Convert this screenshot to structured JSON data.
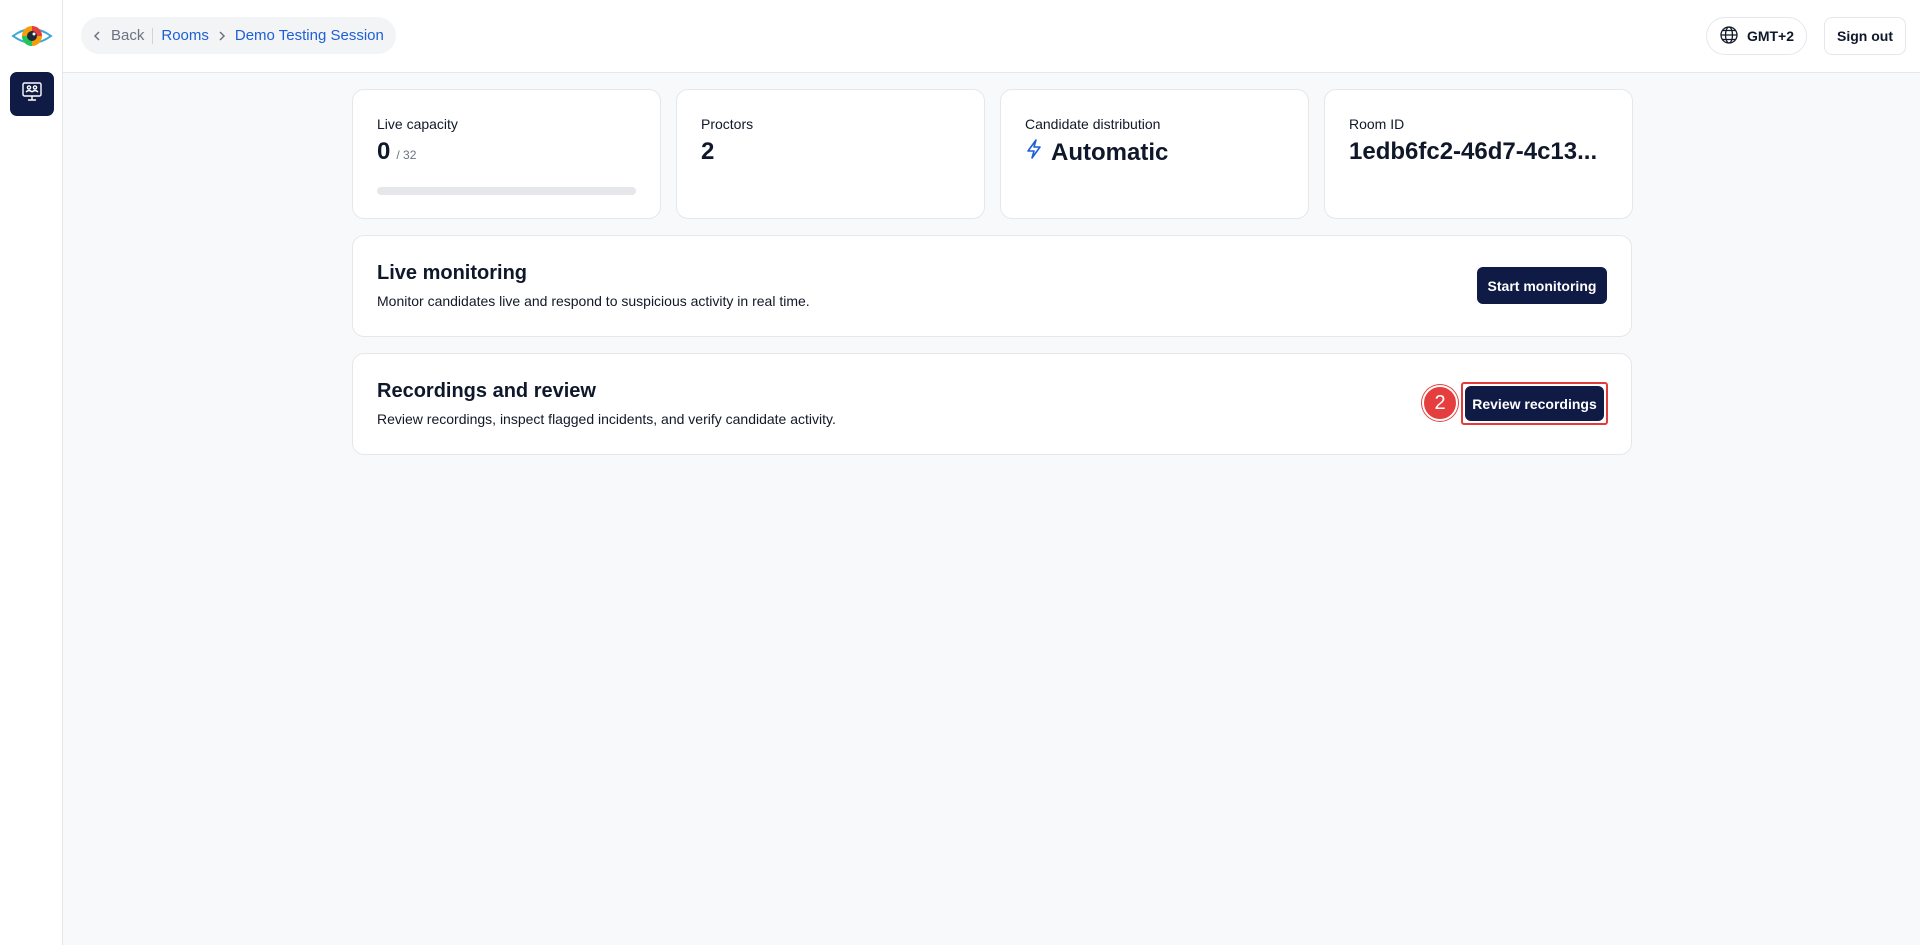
{
  "colors": {
    "primary": "#0f1a45",
    "link": "#1d5fd6",
    "highlight": "#e33b3b"
  },
  "sidebar": {
    "logo_icon": "eye-logo-icon",
    "nav_icon": "monitor-people-icon"
  },
  "breadcrumb": {
    "back_label": "Back",
    "rooms_label": "Rooms",
    "current_label": "Demo Testing Session"
  },
  "header": {
    "timezone_label": "GMT+2",
    "signout_label": "Sign out"
  },
  "stats": {
    "capacity": {
      "label": "Live capacity",
      "value": "0",
      "max": "/ 32",
      "fill_fraction": 0
    },
    "proctors": {
      "label": "Proctors",
      "value": "2"
    },
    "distribution": {
      "label": "Candidate distribution",
      "value": "Automatic",
      "icon": "lightning-icon"
    },
    "room": {
      "label": "Room ID",
      "value": "1edb6fc2-46d7-4c13..."
    }
  },
  "live": {
    "title": "Live monitoring",
    "description": "Monitor candidates live and respond to suspicious activity in real time.",
    "button_label": "Start monitoring"
  },
  "recordings": {
    "title": "Recordings and review",
    "description": "Review recordings, inspect flagged incidents, and verify candidate activity.",
    "button_label": "Review recordings",
    "step_badge": "2"
  }
}
